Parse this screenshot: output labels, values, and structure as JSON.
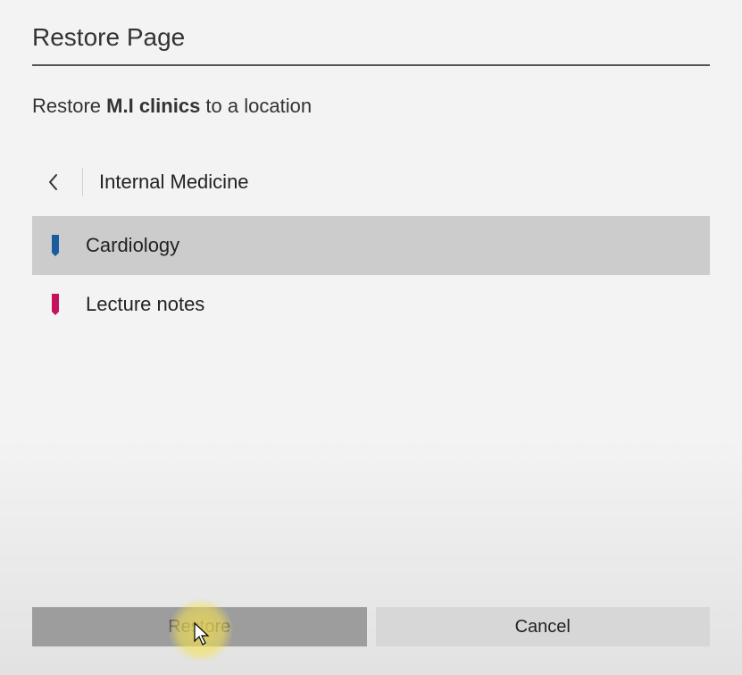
{
  "dialog": {
    "title": "Restore Page",
    "prompt_prefix": "Restore ",
    "prompt_item": "M.I clinics",
    "prompt_suffix": " to a location"
  },
  "nav": {
    "current": "Internal Medicine"
  },
  "items": [
    {
      "label": "Cardiology",
      "color": "#1b5c9e",
      "selected": true
    },
    {
      "label": "Lecture notes",
      "color": "#c4125f",
      "selected": false
    }
  ],
  "buttons": {
    "restore": "Restore",
    "cancel": "Cancel"
  }
}
